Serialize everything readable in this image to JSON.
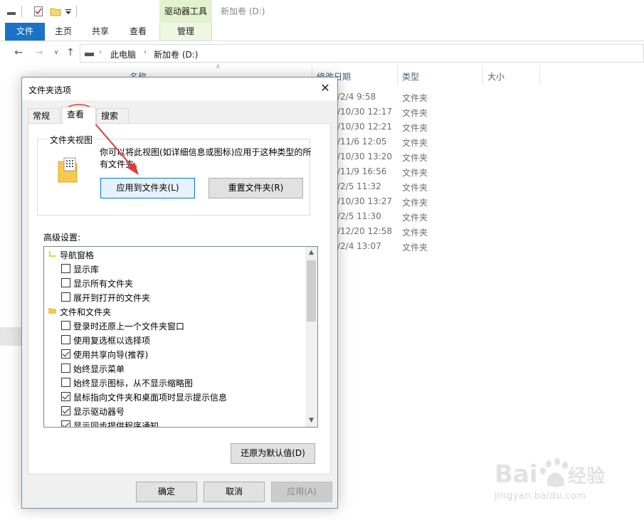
{
  "explorer": {
    "title": "新加卷 (D:)",
    "context_group": "驱动器工具",
    "ribbon_tabs": [
      {
        "label": "文件"
      },
      {
        "label": "主页"
      },
      {
        "label": "共享"
      },
      {
        "label": "查看"
      },
      {
        "label": "管理"
      }
    ],
    "breadcrumb": [
      "此电脑",
      "新加卷 (D:)"
    ],
    "columns": [
      "名称",
      "修改日期",
      "类型",
      "大小"
    ],
    "rows": [
      {
        "date": "/2/4 9:58",
        "type": "文件夹"
      },
      {
        "date": "/10/30 12:17",
        "type": "文件夹"
      },
      {
        "date": "/10/30 12:21",
        "type": "文件夹"
      },
      {
        "date": "/11/6 12:05",
        "type": "文件夹"
      },
      {
        "date": "/10/30 13:20",
        "type": "文件夹"
      },
      {
        "date": "/11/9 16:56",
        "type": "文件夹"
      },
      {
        "date": "/2/5 11:32",
        "type": "文件夹"
      },
      {
        "date": "/10/30 13:27",
        "type": "文件夹"
      },
      {
        "date": "/2/5 11:30",
        "type": "文件夹"
      },
      {
        "date": "/12/20 12:58",
        "type": "文件夹"
      },
      {
        "date": "/2/4 13:07",
        "type": "文件夹"
      }
    ]
  },
  "dialog": {
    "title": "文件夹选项",
    "tabs": [
      "常规",
      "查看",
      "搜索"
    ],
    "folder_views": {
      "label": "文件夹视图",
      "description": "你可以将此视图(如详细信息或图标)应用于这种类型的所有文件夹。",
      "apply_button": "应用到文件夹(L)",
      "reset_button": "重置文件夹(R)"
    },
    "advanced_label": "高级设置:",
    "tree": [
      {
        "kind": "category",
        "label": "导航窗格",
        "icon": "nav-pane-folder-icon"
      },
      {
        "kind": "option",
        "label": "显示库",
        "checked": false
      },
      {
        "kind": "option",
        "label": "显示所有文件夹",
        "checked": false
      },
      {
        "kind": "option",
        "label": "展开到打开的文件夹",
        "checked": false
      },
      {
        "kind": "category",
        "label": "文件和文件夹",
        "icon": "folder-icon"
      },
      {
        "kind": "option",
        "label": "登录时还原上一个文件夹窗口",
        "checked": false
      },
      {
        "kind": "option",
        "label": "使用复选框以选择项",
        "checked": false
      },
      {
        "kind": "option",
        "label": "使用共享向导(推荐)",
        "checked": true
      },
      {
        "kind": "option",
        "label": "始终显示菜单",
        "checked": false
      },
      {
        "kind": "option",
        "label": "始终显示图标，从不显示缩略图",
        "checked": false
      },
      {
        "kind": "option",
        "label": "鼠标指向文件夹和桌面项时显示提示信息",
        "checked": true
      },
      {
        "kind": "option",
        "label": "显示驱动器号",
        "checked": true
      },
      {
        "kind": "option",
        "label": "显示同步提供程序通知",
        "checked": true
      }
    ],
    "restore_button": "还原为默认值(D)",
    "ok_button": "确定",
    "cancel_button": "取消",
    "apply_button": "应用(A)"
  },
  "colors": {
    "accent": "#1a73c8",
    "annotation": "#e53935"
  },
  "watermark": {
    "logo": "Bai经验",
    "url": "jingyan.baidu.com"
  }
}
